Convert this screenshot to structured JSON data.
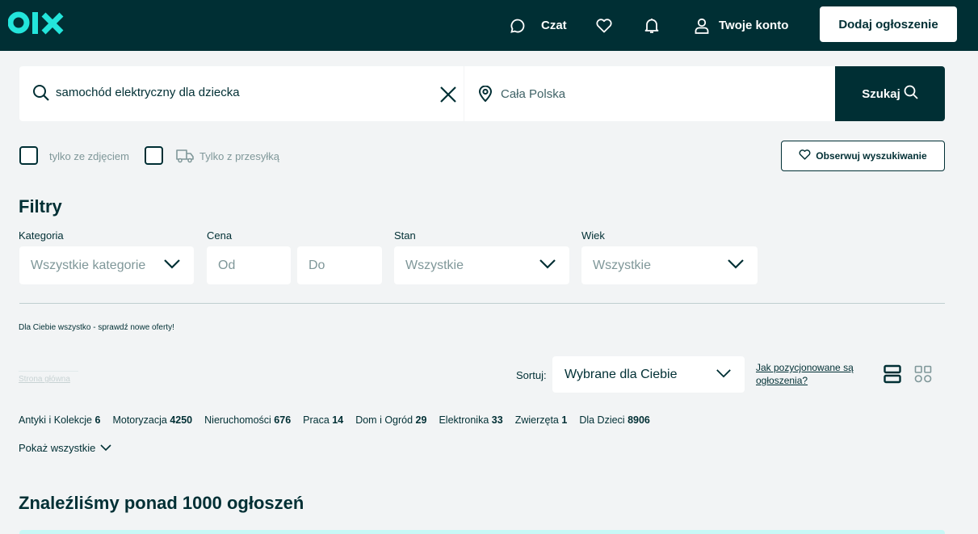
{
  "header": {
    "chat_label": "Czat",
    "account_label": "Twoje konto",
    "add_listing_label": "Dodaj ogłoszenie"
  },
  "search": {
    "query": "samochód elektryczny dla dziecka",
    "location": "Cała Polska",
    "search_button_label": "Szukaj"
  },
  "checkboxes": {
    "with_photo_label": "tylko ze zdjęciem",
    "with_shipping_label": "Tylko z przesyłką"
  },
  "observe_label": "Obserwuj wyszukiwanie",
  "filters": {
    "title": "Filtry",
    "category_label": "Kategoria",
    "category_value": "Wszystkie kategorie",
    "price_label": "Cena",
    "price_from_placeholder": "Od",
    "price_to_placeholder": "Do",
    "condition_label": "Stan",
    "condition_value": "Wszystkie",
    "age_label": "Wiek",
    "age_value": "Wszystkie"
  },
  "promo_text": "Dla Ciebie wszystko - sprawdź nowe oferty!",
  "breadcrumb": "Strona główna",
  "sort": {
    "label": "Sortuj:",
    "value": "Wybrane dla Ciebie",
    "positioning_link": "Jak pozycjonowane są ogłoszenia?"
  },
  "categories": [
    {
      "name": "Antyki i Kolekcje",
      "count": "6"
    },
    {
      "name": "Motoryzacja",
      "count": "4250"
    },
    {
      "name": "Nieruchomości",
      "count": "676"
    },
    {
      "name": "Praca",
      "count": "14"
    },
    {
      "name": "Dom i Ogród",
      "count": "29"
    },
    {
      "name": "Elektronika",
      "count": "33"
    },
    {
      "name": "Zwierzęta",
      "count": "1"
    },
    {
      "name": "Dla Dzieci",
      "count": "8906"
    }
  ],
  "show_all_label": "Pokaż wszystkie",
  "results_title": "Znaleźliśmy ponad 1000 ogłoszeń",
  "colors": {
    "brand_dark": "#002f34",
    "brand_accent": "#23e5db",
    "background": "#f2f4f5"
  }
}
